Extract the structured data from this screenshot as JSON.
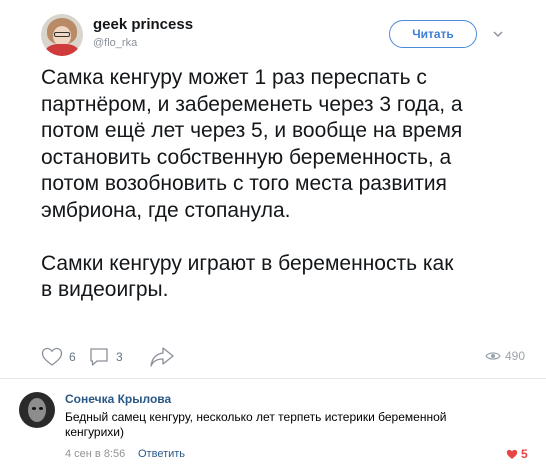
{
  "tweet": {
    "author_name": "geek princess",
    "author_handle": "@flo_rka",
    "follow_label": "Читать",
    "text": "Самка кенгуру может 1 раз переспать с\nпартнёром, и забеременеть через 3 года, а\nпотом ещё лет через 5, и вообще на время\nостановить собственную беременность, а\nпотом возобновить с того места развития\nэмбриона, где стопанула.\n\nСамки кенгуру играют в беременность как\nв видеоигры.",
    "likes": "6",
    "replies": "3",
    "views": "490"
  },
  "comment": {
    "author": "Сонечка Крылова",
    "text": "Бедный самец кенгуру, несколько лет терпеть истерики беременной кенгурихи)",
    "date": "4 сен в 8:56",
    "reply_label": "Ответить",
    "likes": "5"
  },
  "colors": {
    "link": "#2a5885",
    "follow_accent": "#3d7fd4",
    "like_red": "#e64646",
    "muted": "#657786"
  }
}
